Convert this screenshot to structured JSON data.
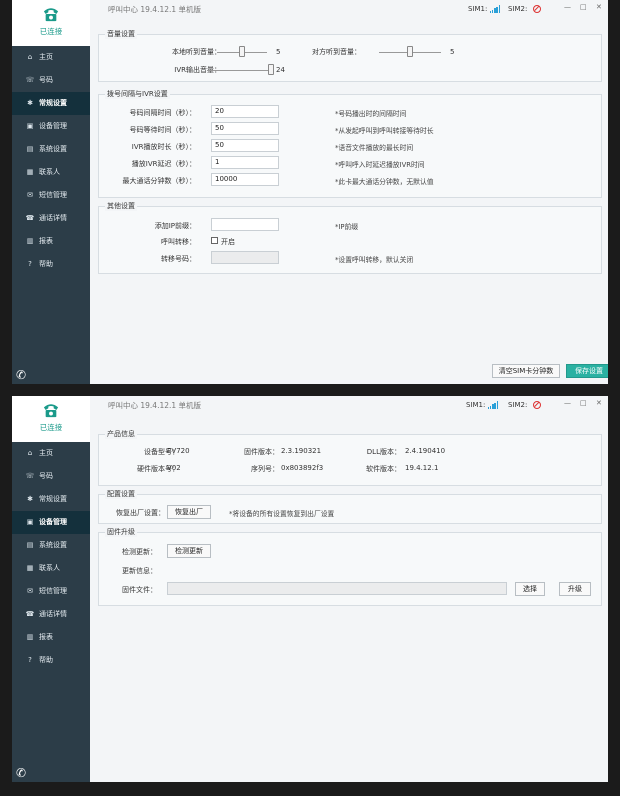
{
  "sidebar": {
    "status": "已连接",
    "items": [
      {
        "label": "主页",
        "icon": "home-icon",
        "glyph": "⌂"
      },
      {
        "label": "号码",
        "icon": "phone-number-icon",
        "glyph": "☏"
      },
      {
        "label": "常规设置",
        "icon": "gear-icon",
        "glyph": "✱"
      },
      {
        "label": "设备管理",
        "icon": "device-icon",
        "glyph": "▣"
      },
      {
        "label": "系统设置",
        "icon": "system-icon",
        "glyph": "▤"
      },
      {
        "label": "联系人",
        "icon": "contacts-icon",
        "glyph": "▦"
      },
      {
        "label": "短信管理",
        "icon": "sms-icon",
        "glyph": "✉"
      },
      {
        "label": "通话详情",
        "icon": "call-detail-icon",
        "glyph": "☎"
      },
      {
        "label": "报表",
        "icon": "report-icon",
        "glyph": "▥"
      },
      {
        "label": "帮助",
        "icon": "help-icon",
        "glyph": "?"
      }
    ]
  },
  "window1": {
    "title": "呼叫中心  19.4.12.1  单机版",
    "sim1": "SIM1:",
    "sim2": "SIM2:",
    "active_item": 2,
    "volume": {
      "legend": "音量设置",
      "local_label": "本地听到音量：",
      "local_value": "5",
      "local_level": 0.5,
      "remote_label": "对方听到音量：",
      "remote_value": "5",
      "remote_level": 0.5,
      "ivr_label": "IVR输出音量：",
      "ivr_value": "24",
      "ivr_level": 1.0
    },
    "dial": {
      "legend": "拨号间隔与IVR设置",
      "rows": [
        {
          "label": "号码间隔时间（秒）：",
          "value": "20",
          "hint": "*号码播出时的间隔时间"
        },
        {
          "label": "号码等待时间（秒）：",
          "value": "50",
          "hint": "*从发起呼叫到呼叫转接等待时长"
        },
        {
          "label": "IVR播放时长（秒）：",
          "value": "50",
          "hint": "*语音文件播放的最长时间"
        },
        {
          "label": "播放IVR延迟（秒）：",
          "value": "1",
          "hint": "*呼叫呼入时延迟播放IVR时间"
        },
        {
          "label": "最大通话分钟数（秒）：",
          "value": "10000",
          "hint": "*此卡最大通话分钟数，无默认值"
        }
      ]
    },
    "other": {
      "legend": "其他设置",
      "ip_label": "添加IP前缀：",
      "ip_value": "",
      "ip_hint": "*IP前缀",
      "forward_label": "呼叫转移：",
      "forward_checkbox_label": "开启",
      "forward_checked": false,
      "number_label": "转移号码：",
      "number_value": "",
      "number_hint": "*设置呼叫转移，默认关闭"
    },
    "clear_button": "清空SIM卡分钟数",
    "save_button": "保存设置"
  },
  "window2": {
    "title": "呼叫中心  19.4.12.1  单机版",
    "sim1": "SIM1:",
    "sim2": "SIM2:",
    "active_item": 3,
    "product": {
      "legend": "产品信息",
      "model_label": "设备型号：",
      "model_value": "EV720",
      "firmware_label": "固件版本：",
      "firmware_value": "2.3.190321",
      "dll_label": "DLL版本：",
      "dll_value": "2.4.190410",
      "hw_label": "硬件版本号：",
      "hw_value": "V02",
      "serial_label": "序列号：",
      "serial_value": "0x803892f3",
      "sw_label": "软件版本：",
      "sw_value": "19.4.12.1"
    },
    "config": {
      "legend": "配置设置",
      "reset_label": "恢复出厂设置：",
      "reset_button": "恢复出厂",
      "reset_hint": "*将设备的所有设置恢复到出厂设置"
    },
    "upgrade": {
      "legend": "固件升级",
      "check_label": "检测更新：",
      "check_button": "检测更新",
      "info_label": "更新信息：",
      "file_label": "固件文件：",
      "file_value": "",
      "select_button": "选择",
      "upgrade_button": "升级"
    }
  }
}
